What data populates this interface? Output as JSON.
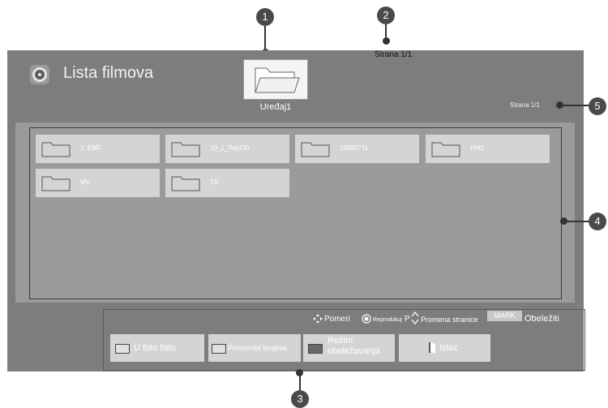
{
  "header": {
    "title": "Lista filmova",
    "device_label": "Uređaj1",
    "page_top": "Strana 1/1",
    "page_right": "Strana 1/1"
  },
  "files": [
    {
      "name": "1. EMF"
    },
    {
      "name": "10_1_Top100"
    },
    {
      "name": "20090711"
    },
    {
      "name": "FHD"
    },
    {
      "name": "MV"
    },
    {
      "name": "TS"
    }
  ],
  "hints": {
    "move": "Pomeri",
    "play": "Reprodukuj",
    "p_key": "P",
    "change_page": "Promena stranice",
    "mark_key": "MARK",
    "mark": "Obeležiti"
  },
  "buttons": [
    {
      "label": "U foto listu",
      "color": "#e8d000"
    },
    {
      "label": "Promenite brojeve",
      "color": "#2a8fd6"
    },
    {
      "label": "Režim obeležavanja",
      "color": "#d03a2a"
    },
    {
      "label": "Izlaz"
    }
  ],
  "callouts": [
    "1",
    "2",
    "3",
    "4",
    "5"
  ]
}
